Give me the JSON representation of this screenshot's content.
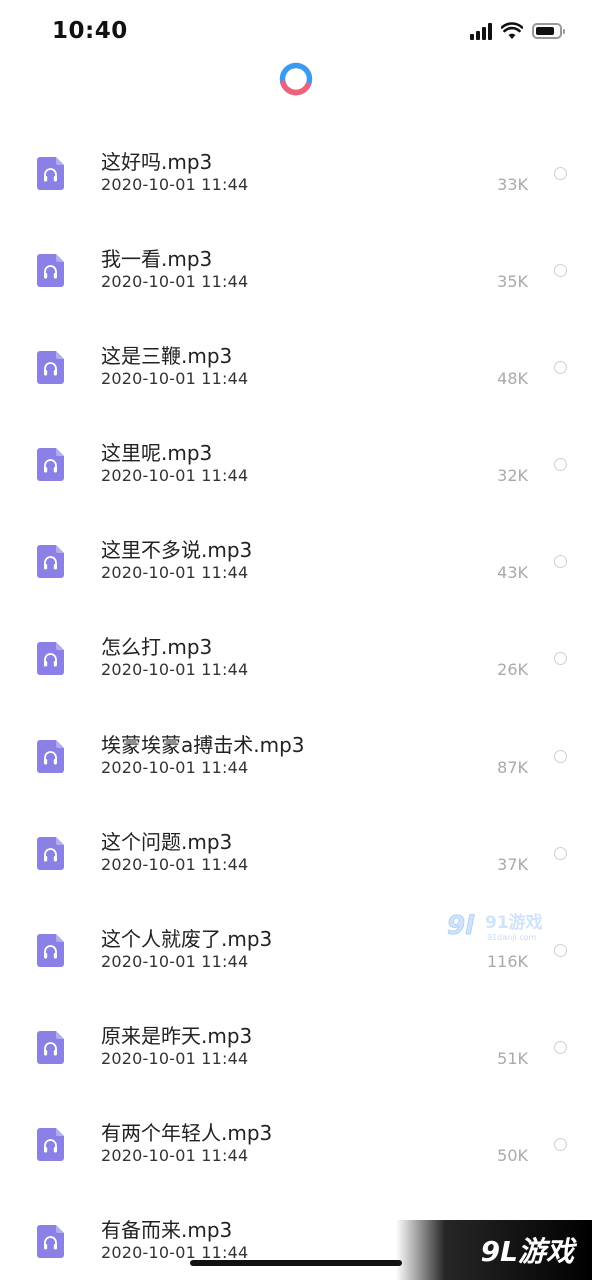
{
  "status_bar": {
    "time": "10:40"
  },
  "files": [
    {
      "name": "这好吗.mp3",
      "date": "2020-10-01 11:44",
      "size": "33K"
    },
    {
      "name": "我一看.mp3",
      "date": "2020-10-01 11:44",
      "size": "35K"
    },
    {
      "name": "这是三鞭.mp3",
      "date": "2020-10-01 11:44",
      "size": "48K"
    },
    {
      "name": "这里呢.mp3",
      "date": "2020-10-01 11:44",
      "size": "32K"
    },
    {
      "name": "这里不多说.mp3",
      "date": "2020-10-01 11:44",
      "size": "43K"
    },
    {
      "name": "怎么打.mp3",
      "date": "2020-10-01 11:44",
      "size": "26K"
    },
    {
      "name": "埃蒙埃蒙a搏击术.mp3",
      "date": "2020-10-01 11:44",
      "size": "87K"
    },
    {
      "name": "这个问题.mp3",
      "date": "2020-10-01 11:44",
      "size": "37K"
    },
    {
      "name": "这个人就废了.mp3",
      "date": "2020-10-01 11:44",
      "size": "116K"
    },
    {
      "name": "原来是昨天.mp3",
      "date": "2020-10-01 11:44",
      "size": "51K"
    },
    {
      "name": "有两个年轻人.mp3",
      "date": "2020-10-01 11:44",
      "size": "50K"
    },
    {
      "name": "有备而来.mp3",
      "date": "2020-10-01 11:44",
      "size": ""
    }
  ],
  "watermark": {
    "small_logo_text": "91游戏",
    "small_url": "91danji.com",
    "corner_text": "9L游戏"
  },
  "colors": {
    "file_icon": "#8a80e6",
    "spinner_blue": "#3b9bf0",
    "spinner_pink": "#f0607a",
    "size_text": "#aaaaaa",
    "radio_border": "#cfcfcf"
  },
  "icons": {
    "file_type": "audio-file-icon",
    "selection": "radio-circle-icon"
  }
}
